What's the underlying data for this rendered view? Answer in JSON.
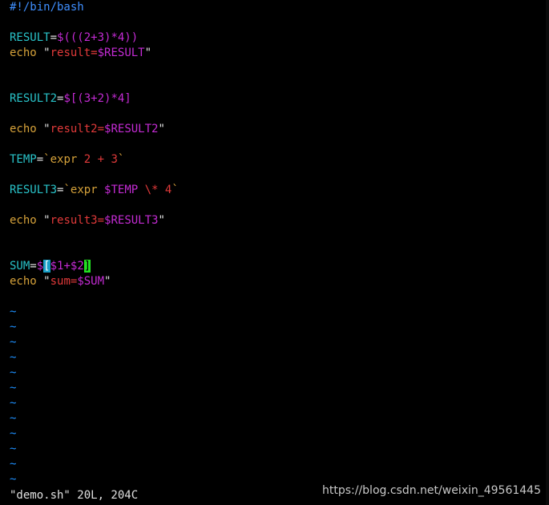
{
  "editor": {
    "lines": [
      [
        {
          "t": "#!/bin/bash",
          "c": "#3f8fff"
        }
      ],
      [],
      [
        {
          "t": "RESULT",
          "c": "#29c3c9"
        },
        {
          "t": "=",
          "c": "#e0e0e0"
        },
        {
          "t": "$(((2+3)*4))",
          "c": "#c42bd4"
        }
      ],
      [
        {
          "t": "echo ",
          "c": "#d6a23a"
        },
        {
          "t": "\"",
          "c": "#e0e0e0"
        },
        {
          "t": "result=",
          "c": "#e23a3a"
        },
        {
          "t": "$RESULT",
          "c": "#c42bd4"
        },
        {
          "t": "\"",
          "c": "#e0e0e0"
        }
      ],
      [],
      [],
      [
        {
          "t": "RESULT2",
          "c": "#29c3c9"
        },
        {
          "t": "=",
          "c": "#e0e0e0"
        },
        {
          "t": "$[(3+2)*4]",
          "c": "#c42bd4"
        }
      ],
      [],
      [
        {
          "t": "echo ",
          "c": "#d6a23a"
        },
        {
          "t": "\"",
          "c": "#e0e0e0"
        },
        {
          "t": "result2=",
          "c": "#e23a3a"
        },
        {
          "t": "$RESULT2",
          "c": "#c42bd4"
        },
        {
          "t": "\"",
          "c": "#e0e0e0"
        }
      ],
      [],
      [
        {
          "t": "TEMP",
          "c": "#29c3c9"
        },
        {
          "t": "=",
          "c": "#e0e0e0"
        },
        {
          "t": "`",
          "c": "#d6a23a"
        },
        {
          "t": "expr ",
          "c": "#d6a23a"
        },
        {
          "t": "2 + 3",
          "c": "#e23a3a"
        },
        {
          "t": "`",
          "c": "#d6a23a"
        }
      ],
      [],
      [
        {
          "t": "RESULT3",
          "c": "#29c3c9"
        },
        {
          "t": "=",
          "c": "#e0e0e0"
        },
        {
          "t": "`",
          "c": "#d6a23a"
        },
        {
          "t": "expr ",
          "c": "#d6a23a"
        },
        {
          "t": "$TEMP",
          "c": "#c42bd4"
        },
        {
          "t": " \\* 4",
          "c": "#e23a3a"
        },
        {
          "t": "`",
          "c": "#d6a23a"
        }
      ],
      [],
      [
        {
          "t": "echo ",
          "c": "#d6a23a"
        },
        {
          "t": "\"",
          "c": "#e0e0e0"
        },
        {
          "t": "result3=",
          "c": "#e23a3a"
        },
        {
          "t": "$RESULT3",
          "c": "#c42bd4"
        },
        {
          "t": "\"",
          "c": "#e0e0e0"
        }
      ],
      [],
      [],
      [
        {
          "t": "SUM",
          "c": "#29c3c9"
        },
        {
          "t": "=",
          "c": "#e0e0e0"
        },
        {
          "t": "$",
          "c": "#c42bd4"
        },
        {
          "t": "[",
          "c": "#ffffff",
          "bg": "#1aa0c8"
        },
        {
          "t": "$1+$2",
          "c": "#c42bd4"
        },
        {
          "t": "]",
          "c": "#000000",
          "bg": "#22e022"
        }
      ],
      [
        {
          "t": "echo ",
          "c": "#d6a23a"
        },
        {
          "t": "\"",
          "c": "#e0e0e0"
        },
        {
          "t": "sum=",
          "c": "#e23a3a"
        },
        {
          "t": "$SUM",
          "c": "#c42bd4"
        },
        {
          "t": "\"",
          "c": "#e0e0e0"
        }
      ],
      []
    ],
    "tilde_lines": [
      "~",
      "~",
      "~",
      "~",
      "~",
      "~",
      "~",
      "~",
      "~",
      "~",
      "~",
      "~"
    ]
  },
  "status_line": "\"demo.sh\" 20L, 204C",
  "watermark": "https://blog.csdn.net/weixin_49561445"
}
